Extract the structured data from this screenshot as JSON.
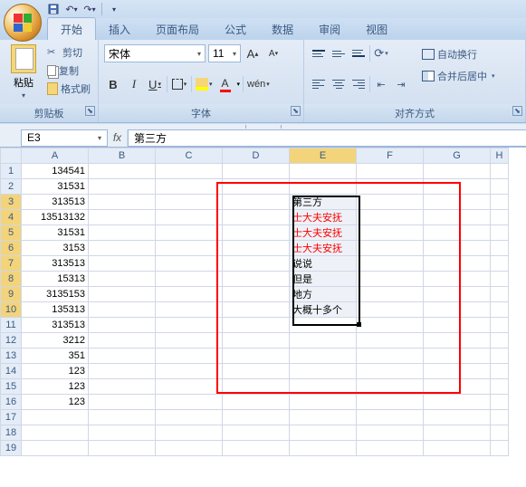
{
  "qat": {
    "save_tip": "保存",
    "undo_tip": "撤销",
    "redo_tip": "重做"
  },
  "tabs": {
    "home": "开始",
    "insert": "插入",
    "layout": "页面布局",
    "formulas": "公式",
    "data": "数据",
    "review": "审阅",
    "view": "视图"
  },
  "clipboard": {
    "paste": "粘贴",
    "cut": "剪切",
    "copy": "复制",
    "format_painter": "格式刷",
    "group": "剪贴板"
  },
  "font": {
    "name": "宋体",
    "size": "11",
    "group": "字体"
  },
  "align": {
    "wrap": "自动换行",
    "merge": "合并后居中",
    "group": "对齐方式"
  },
  "namebox": "E3",
  "formula": "第三方",
  "cols": [
    "A",
    "B",
    "C",
    "D",
    "E",
    "F",
    "G",
    "H"
  ],
  "rows": [
    "1",
    "2",
    "3",
    "4",
    "5",
    "6",
    "7",
    "8",
    "9",
    "10",
    "11",
    "12",
    "13",
    "14",
    "15",
    "16",
    "17",
    "18",
    "19"
  ],
  "colA": [
    "134541",
    "31531",
    "313513",
    "13513132",
    "31531",
    "3153",
    "313513",
    "15313",
    "3135153",
    "135313",
    "313513",
    "3212",
    "351",
    "123",
    "123",
    "123",
    "",
    "",
    ""
  ],
  "colE": [
    "",
    "",
    "第三方",
    "士大夫安抚",
    "士大夫安抚",
    "士大夫安抚",
    "说说",
    "但是",
    "地方",
    "大概十多个",
    "",
    "",
    "",
    "",
    "",
    "",
    "",
    "",
    ""
  ],
  "red_rows": [
    3,
    4,
    5
  ],
  "sel": {
    "col": 4,
    "r0": 2,
    "r1": 9
  },
  "chart_data": null
}
